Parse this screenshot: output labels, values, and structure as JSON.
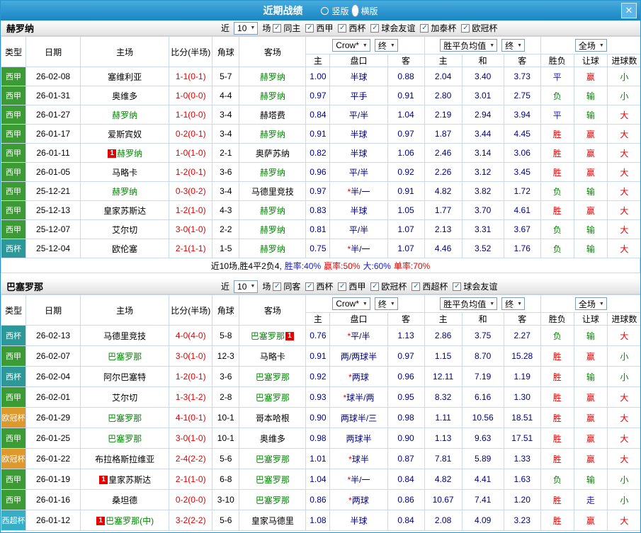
{
  "titlebar": {
    "title": "近期战绩",
    "vertical_label": "竖版",
    "horizontal_label": "横版",
    "close_glyph": "✕"
  },
  "table_head": {
    "type": "类型",
    "date": "日期",
    "home": "主场",
    "score": "比分(半场)",
    "corner": "角球",
    "away": "客场",
    "sub": [
      "主",
      "盘口",
      "客",
      "主",
      "和",
      "客",
      "胜负",
      "让球",
      "进球数"
    ],
    "bookmaker_select": "Crow*",
    "final_select": "终",
    "avg_select": "胜平负均值",
    "final_select2": "终",
    "fullmatch_select": "全场"
  },
  "type_colors": {
    "西甲": "#3d9b35",
    "西杯": "#2e9898",
    "欧冠杯": "#dd982e",
    "西超杯": "#35aec6"
  },
  "result_colors": {
    "胜": "#e60000",
    "平": "#1414e6",
    "负": "#008800",
    "赢": "#e60000",
    "走": "#1414e6",
    "输": "#008800",
    "大": "#e60000",
    "小": "#008800"
  },
  "sections": [
    {
      "team": "赫罗纳",
      "filter": {
        "near": "近",
        "count": "10",
        "unit": "场",
        "checks": [
          {
            "label": "同主",
            "checked": true
          },
          {
            "label": "西甲",
            "checked": true
          },
          {
            "label": "西杯",
            "checked": true
          },
          {
            "label": "球会友谊",
            "checked": true
          },
          {
            "label": "加泰杯",
            "checked": true
          },
          {
            "label": "欧冠杯",
            "checked": true
          }
        ]
      },
      "rows": [
        {
          "type": "西甲",
          "date": "26-02-08",
          "home": "塞维利亚",
          "home_focus": false,
          "home_badge": "",
          "score": "1-1(0-1)",
          "corner": "5-7",
          "away": "赫罗纳",
          "away_focus": true,
          "away_badge": "",
          "h": "1.00",
          "hcap": "半球",
          "a": "0.88",
          "eu_h": "2.04",
          "eu_d": "3.40",
          "eu_a": "3.73",
          "res": "平",
          "handicap_res": "赢",
          "total": "小"
        },
        {
          "type": "西甲",
          "date": "26-01-31",
          "home": "奥维多",
          "home_focus": false,
          "home_badge": "",
          "score": "1-0(0-0)",
          "corner": "4-4",
          "away": "赫罗纳",
          "away_focus": true,
          "away_badge": "",
          "h": "0.97",
          "hcap": "平手",
          "a": "0.91",
          "eu_h": "2.80",
          "eu_d": "3.01",
          "eu_a": "2.75",
          "res": "负",
          "handicap_res": "输",
          "total": "小"
        },
        {
          "type": "西甲",
          "date": "26-01-27",
          "home": "赫罗纳",
          "home_focus": true,
          "home_badge": "",
          "score": "1-1(0-0)",
          "corner": "3-4",
          "away": "赫塔费",
          "away_focus": false,
          "away_badge": "",
          "h": "0.84",
          "hcap": "平/半",
          "a": "1.04",
          "eu_h": "2.19",
          "eu_d": "2.94",
          "eu_a": "3.94",
          "res": "平",
          "handicap_res": "输",
          "total": "大"
        },
        {
          "type": "西甲",
          "date": "26-01-17",
          "home": "爱斯宾奴",
          "home_focus": false,
          "home_badge": "",
          "score": "0-2(0-1)",
          "corner": "3-4",
          "away": "赫罗纳",
          "away_focus": true,
          "away_badge": "",
          "h": "0.91",
          "hcap": "半球",
          "a": "0.97",
          "eu_h": "1.87",
          "eu_d": "3.44",
          "eu_a": "4.45",
          "res": "胜",
          "handicap_res": "赢",
          "total": "大"
        },
        {
          "type": "西甲",
          "date": "26-01-11",
          "home": "赫罗纳",
          "home_focus": true,
          "home_badge": "1",
          "score": "1-0(1-0)",
          "corner": "2-1",
          "away": "奥萨苏纳",
          "away_focus": false,
          "away_badge": "",
          "h": "0.82",
          "hcap": "半球",
          "a": "1.06",
          "eu_h": "2.46",
          "eu_d": "3.14",
          "eu_a": "3.06",
          "res": "胜",
          "handicap_res": "赢",
          "total": "大"
        },
        {
          "type": "西甲",
          "date": "26-01-05",
          "home": "马略卡",
          "home_focus": false,
          "home_badge": "",
          "score": "1-2(0-1)",
          "corner": "3-6",
          "away": "赫罗纳",
          "away_focus": true,
          "away_badge": "",
          "h": "0.96",
          "hcap": "平/半",
          "a": "0.92",
          "eu_h": "2.26",
          "eu_d": "3.12",
          "eu_a": "3.45",
          "res": "胜",
          "handicap_res": "赢",
          "total": "大"
        },
        {
          "type": "西甲",
          "date": "25-12-21",
          "home": "赫罗纳",
          "home_focus": true,
          "home_badge": "",
          "score": "0-3(0-2)",
          "corner": "3-4",
          "away": "马德里竞技",
          "away_focus": false,
          "away_badge": "",
          "h": "0.97",
          "hcap": "*半/一",
          "a": "0.91",
          "eu_h": "4.82",
          "eu_d": "3.82",
          "eu_a": "1.72",
          "res": "负",
          "handicap_res": "输",
          "total": "大"
        },
        {
          "type": "西甲",
          "date": "25-12-13",
          "home": "皇家苏斯达",
          "home_focus": false,
          "home_badge": "",
          "score": "1-2(1-0)",
          "corner": "4-3",
          "away": "赫罗纳",
          "away_focus": true,
          "away_badge": "",
          "h": "0.83",
          "hcap": "半球",
          "a": "1.05",
          "eu_h": "1.77",
          "eu_d": "3.70",
          "eu_a": "4.61",
          "res": "胜",
          "handicap_res": "赢",
          "total": "大"
        },
        {
          "type": "西甲",
          "date": "25-12-07",
          "home": "艾尔切",
          "home_focus": false,
          "home_badge": "",
          "score": "3-0(1-0)",
          "corner": "2-2",
          "away": "赫罗纳",
          "away_focus": true,
          "away_badge": "",
          "h": "0.81",
          "hcap": "平/半",
          "a": "1.07",
          "eu_h": "2.13",
          "eu_d": "3.31",
          "eu_a": "3.67",
          "res": "负",
          "handicap_res": "输",
          "total": "大"
        },
        {
          "type": "西杯",
          "date": "25-12-04",
          "home": "欧伦塞",
          "home_focus": false,
          "home_badge": "",
          "score": "2-1(1-1)",
          "corner": "1-5",
          "away": "赫罗纳",
          "away_focus": true,
          "away_badge": "",
          "h": "0.75",
          "hcap": "*半/一",
          "a": "1.07",
          "eu_h": "4.46",
          "eu_d": "3.52",
          "eu_a": "1.76",
          "res": "负",
          "handicap_res": "输",
          "total": "大"
        }
      ],
      "summary": [
        {
          "text": "近10场,胜4平2负4,",
          "color": "#000000"
        },
        {
          "text": "胜率:40%",
          "color": "#1414e6"
        },
        {
          "text": "赢率:50%",
          "color": "#e60000"
        },
        {
          "text": "大:60%",
          "color": "#1414e6"
        },
        {
          "text": "单率:70%",
          "color": "#e60000"
        }
      ]
    },
    {
      "team": "巴塞罗那",
      "filter": {
        "near": "近",
        "count": "10",
        "unit": "场",
        "checks": [
          {
            "label": "同客",
            "checked": true
          },
          {
            "label": "西杯",
            "checked": true
          },
          {
            "label": "西甲",
            "checked": true
          },
          {
            "label": "欧冠杯",
            "checked": true
          },
          {
            "label": "西超杯",
            "checked": true
          },
          {
            "label": "球会友谊",
            "checked": true
          }
        ]
      },
      "rows": [
        {
          "type": "西杯",
          "date": "26-02-13",
          "home": "马德里竞技",
          "home_focus": false,
          "home_badge": "",
          "score": "4-0(4-0)",
          "corner": "5-8",
          "away": "巴塞罗那",
          "away_focus": true,
          "away_badge": "1",
          "h": "0.76",
          "hcap": "*平/半",
          "a": "1.13",
          "eu_h": "2.86",
          "eu_d": "3.75",
          "eu_a": "2.27",
          "res": "负",
          "handicap_res": "输",
          "total": "大"
        },
        {
          "type": "西甲",
          "date": "26-02-07",
          "home": "巴塞罗那",
          "home_focus": true,
          "home_badge": "",
          "score": "3-0(1-0)",
          "corner": "12-3",
          "away": "马略卡",
          "away_focus": false,
          "away_badge": "",
          "h": "0.91",
          "hcap": "两/两球半",
          "a": "0.97",
          "eu_h": "1.15",
          "eu_d": "8.70",
          "eu_a": "15.28",
          "res": "胜",
          "handicap_res": "赢",
          "total": "小"
        },
        {
          "type": "西杯",
          "date": "26-02-04",
          "home": "阿尔巴塞特",
          "home_focus": false,
          "home_badge": "",
          "score": "1-2(0-1)",
          "corner": "3-6",
          "away": "巴塞罗那",
          "away_focus": true,
          "away_badge": "",
          "h": "0.92",
          "hcap": "*两球",
          "a": "0.96",
          "eu_h": "12.11",
          "eu_d": "7.19",
          "eu_a": "1.19",
          "res": "胜",
          "handicap_res": "输",
          "total": "小"
        },
        {
          "type": "西甲",
          "date": "26-02-01",
          "home": "艾尔切",
          "home_focus": false,
          "home_badge": "",
          "score": "1-3(1-2)",
          "corner": "2-8",
          "away": "巴塞罗那",
          "away_focus": true,
          "away_badge": "",
          "h": "0.93",
          "hcap": "*球半/两",
          "a": "0.95",
          "eu_h": "8.32",
          "eu_d": "6.16",
          "eu_a": "1.30",
          "res": "胜",
          "handicap_res": "赢",
          "total": "大"
        },
        {
          "type": "欧冠杯",
          "date": "26-01-29",
          "home": "巴塞罗那",
          "home_focus": true,
          "home_badge": "",
          "score": "4-1(0-1)",
          "corner": "10-1",
          "away": "哥本哈根",
          "away_focus": false,
          "away_badge": "",
          "h": "0.90",
          "hcap": "两球半/三",
          "a": "0.98",
          "eu_h": "1.11",
          "eu_d": "10.56",
          "eu_a": "18.51",
          "res": "胜",
          "handicap_res": "赢",
          "total": "大"
        },
        {
          "type": "西甲",
          "date": "26-01-25",
          "home": "巴塞罗那",
          "home_focus": true,
          "home_badge": "",
          "score": "3-0(1-0)",
          "corner": "10-1",
          "away": "奥维多",
          "away_focus": false,
          "away_badge": "",
          "h": "0.98",
          "hcap": "两球半",
          "a": "0.90",
          "eu_h": "1.13",
          "eu_d": "9.63",
          "eu_a": "17.51",
          "res": "胜",
          "handicap_res": "赢",
          "total": "大"
        },
        {
          "type": "欧冠杯",
          "date": "26-01-22",
          "home": "布拉格斯拉维亚",
          "home_focus": false,
          "home_badge": "",
          "score": "2-4(2-2)",
          "corner": "5-6",
          "away": "巴塞罗那",
          "away_focus": true,
          "away_badge": "",
          "h": "1.01",
          "hcap": "*球半",
          "a": "0.87",
          "eu_h": "7.81",
          "eu_d": "5.89",
          "eu_a": "1.33",
          "res": "胜",
          "handicap_res": "赢",
          "total": "大"
        },
        {
          "type": "西甲",
          "date": "26-01-19",
          "home": "皇家苏斯达",
          "home_focus": false,
          "home_badge": "1",
          "score": "2-1(1-0)",
          "corner": "6-8",
          "away": "巴塞罗那",
          "away_focus": true,
          "away_badge": "",
          "h": "1.04",
          "hcap": "*半/一",
          "a": "0.84",
          "eu_h": "4.82",
          "eu_d": "4.41",
          "eu_a": "1.63",
          "res": "负",
          "handicap_res": "输",
          "total": "小"
        },
        {
          "type": "西甲",
          "date": "26-01-16",
          "home": "桑坦德",
          "home_focus": false,
          "home_badge": "",
          "score": "0-2(0-0)",
          "corner": "3-10",
          "away": "巴塞罗那",
          "away_focus": true,
          "away_badge": "",
          "h": "0.86",
          "hcap": "*两球",
          "a": "0.86",
          "eu_h": "10.67",
          "eu_d": "7.41",
          "eu_a": "1.20",
          "res": "胜",
          "handicap_res": "走",
          "total": "小"
        },
        {
          "type": "西超杯",
          "date": "26-01-12",
          "home": "巴塞罗那(中)",
          "home_focus": true,
          "home_badge": "1",
          "score": "3-2(2-2)",
          "corner": "5-6",
          "away": "皇家马德里",
          "away_focus": false,
          "away_badge": "",
          "h": "1.08",
          "hcap": "半球",
          "a": "0.84",
          "eu_h": "2.08",
          "eu_d": "4.09",
          "eu_a": "3.23",
          "res": "胜",
          "handicap_res": "赢",
          "total": "大"
        }
      ],
      "summary": []
    }
  ]
}
